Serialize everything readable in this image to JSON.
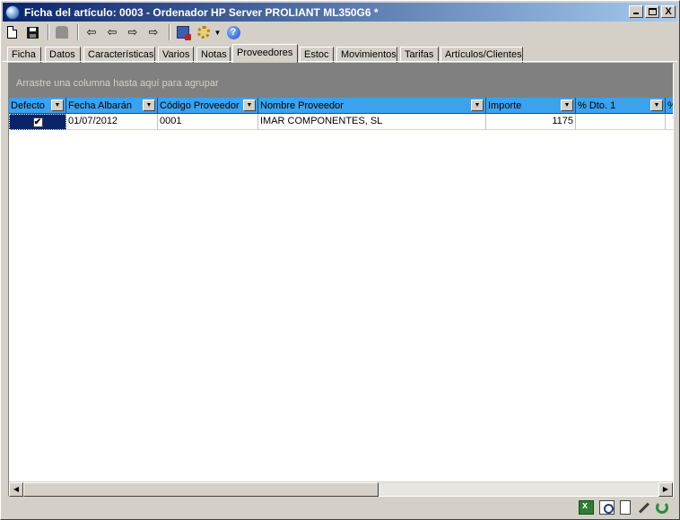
{
  "window": {
    "title": "Ficha del artículo:  0003 - Ordenador HP Server PROLIANT ML350G6 *",
    "controls": {
      "minimize": "_",
      "maximize": "□",
      "close": "X"
    }
  },
  "toolbar": {
    "icons": [
      "new-document-icon",
      "save-icon",
      "stamp-icon",
      "first-record-icon",
      "previous-record-icon",
      "next-record-icon",
      "last-record-icon",
      "calculator-icon",
      "settings-icon",
      "dropdown-icon",
      "help-icon"
    ],
    "arrows": {
      "first": "⇦",
      "prev": "⇦",
      "next": "⇨",
      "last": "⇨"
    },
    "help": "?"
  },
  "tabs": [
    {
      "label": "Ficha"
    },
    {
      "label": "Datos"
    },
    {
      "label": "Características"
    },
    {
      "label": "Varios"
    },
    {
      "label": "Notas"
    },
    {
      "label": "Proveedores",
      "active": true
    },
    {
      "label": "Estoc"
    },
    {
      "label": "Movimientos"
    },
    {
      "label": "Tarifas"
    },
    {
      "label": "Artículos/Clientes"
    }
  ],
  "grid": {
    "group_hint": "Arrastre una columna hasta aquí para agrupar",
    "columns": [
      "Defecto",
      "Fecha Albarán",
      "Código Proveedor",
      "Nombre Proveedor",
      "Importe",
      "% Dto. 1",
      "%"
    ],
    "rows": [
      {
        "defecto": "✔",
        "fecha": "01/07/2012",
        "codigo": "0001",
        "nombre": "IMAR COMPONENTES, SL",
        "importe": "1175",
        "dto1": ""
      }
    ]
  },
  "scrollbar": {
    "left": "◀",
    "right": "▶"
  },
  "bottom_icons": [
    "excel-export-icon",
    "print-preview-icon",
    "page-icon",
    "edit-icon",
    "refresh-icon"
  ],
  "colors": {
    "title_start": "#0a246a",
    "title_end": "#a6caf0",
    "header_bg": "#3aa2ee",
    "group_bg": "#808080",
    "selection": "#0a246a"
  }
}
